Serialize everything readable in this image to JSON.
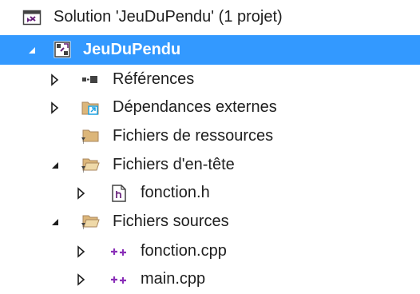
{
  "solution_explorer": {
    "items": [
      {
        "label": "Solution 'JeuDuPendu' (1 projet)",
        "icon": "solution-icon",
        "expander": "none"
      },
      {
        "label": "JeuDuPendu",
        "icon": "project-icon",
        "expander": "expanded",
        "selected": true
      },
      {
        "label": "Références",
        "icon": "references-icon",
        "expander": "collapsed"
      },
      {
        "label": "Dépendances externes",
        "icon": "external-dependencies-icon",
        "expander": "collapsed"
      },
      {
        "label": "Fichiers de ressources",
        "icon": "filter-folder-icon",
        "expander": "none"
      },
      {
        "label": "Fichiers d'en-tête",
        "icon": "filter-folder-open-icon",
        "expander": "expanded"
      },
      {
        "label": "fonction.h",
        "icon": "header-file-icon",
        "expander": "collapsed"
      },
      {
        "label": "Fichiers sources",
        "icon": "filter-folder-open-icon",
        "expander": "expanded"
      },
      {
        "label": "fonction.cpp",
        "icon": "cpp-file-icon",
        "expander": "collapsed"
      },
      {
        "label": "main.cpp",
        "icon": "cpp-file-icon",
        "expander": "collapsed"
      }
    ]
  },
  "colors": {
    "selection_background": "#3399ff",
    "text": "#1e1e1e",
    "solution_purple": "#68217a",
    "cpp_purple": "#8a2fb8",
    "folder_tan": "#dcb67a",
    "folder_dark": "#a8865c",
    "reference_dark": "#424242",
    "external_blue": "#1ba1e2"
  }
}
